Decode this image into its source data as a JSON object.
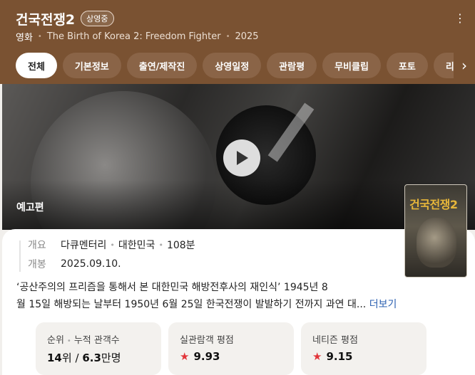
{
  "header": {
    "title": "건국전쟁2",
    "status_badge": "상영중",
    "genre": "영화",
    "english_title": "The Birth of Korea 2: Freedom Fighter",
    "year": "2025",
    "more_icon": "more-vertical-icon"
  },
  "tabs": [
    {
      "label": "전체",
      "active": true
    },
    {
      "label": "기본정보",
      "active": false
    },
    {
      "label": "출연/제작진",
      "active": false
    },
    {
      "label": "상영일정",
      "active": false
    },
    {
      "label": "관람평",
      "active": false
    },
    {
      "label": "무비클립",
      "active": false
    },
    {
      "label": "포토",
      "active": false
    },
    {
      "label": "리뷰",
      "active": false
    }
  ],
  "hero": {
    "trailer_label": "예고편",
    "play_icon": "play-icon"
  },
  "poster": {
    "title": "건국전쟁2"
  },
  "info": {
    "overview_label": "개요",
    "genre": "다큐멘터리",
    "country": "대한민국",
    "runtime": "108분",
    "release_label": "개봉",
    "release_date": "2025.09.10."
  },
  "synopsis": {
    "line1": "‘공산주의의 프리즘을 통해서 본 대한민국 해방전후사의 재인식’ 1945년 8",
    "line2": "월 15일 해방되는 날부터 1950년 6월 25일 한국전쟁이 발발하기 전까지 과연 대...",
    "more_label": "더보기"
  },
  "stats": {
    "rank_label": "순위",
    "audience_label": "누적 관객수",
    "rank_value": "14",
    "rank_unit": "위",
    "divider": "/",
    "audience_value": "6.3",
    "audience_unit": "만명",
    "real_audience_label": "실관람객 평점",
    "real_audience_score": "9.93",
    "netizen_label": "네티즌 평점",
    "netizen_score": "9.15"
  },
  "colors": {
    "header_bg": "#7a5232",
    "active_tab_bg": "#ffffff",
    "star": "#e2353a",
    "link": "#2a5fb0"
  }
}
